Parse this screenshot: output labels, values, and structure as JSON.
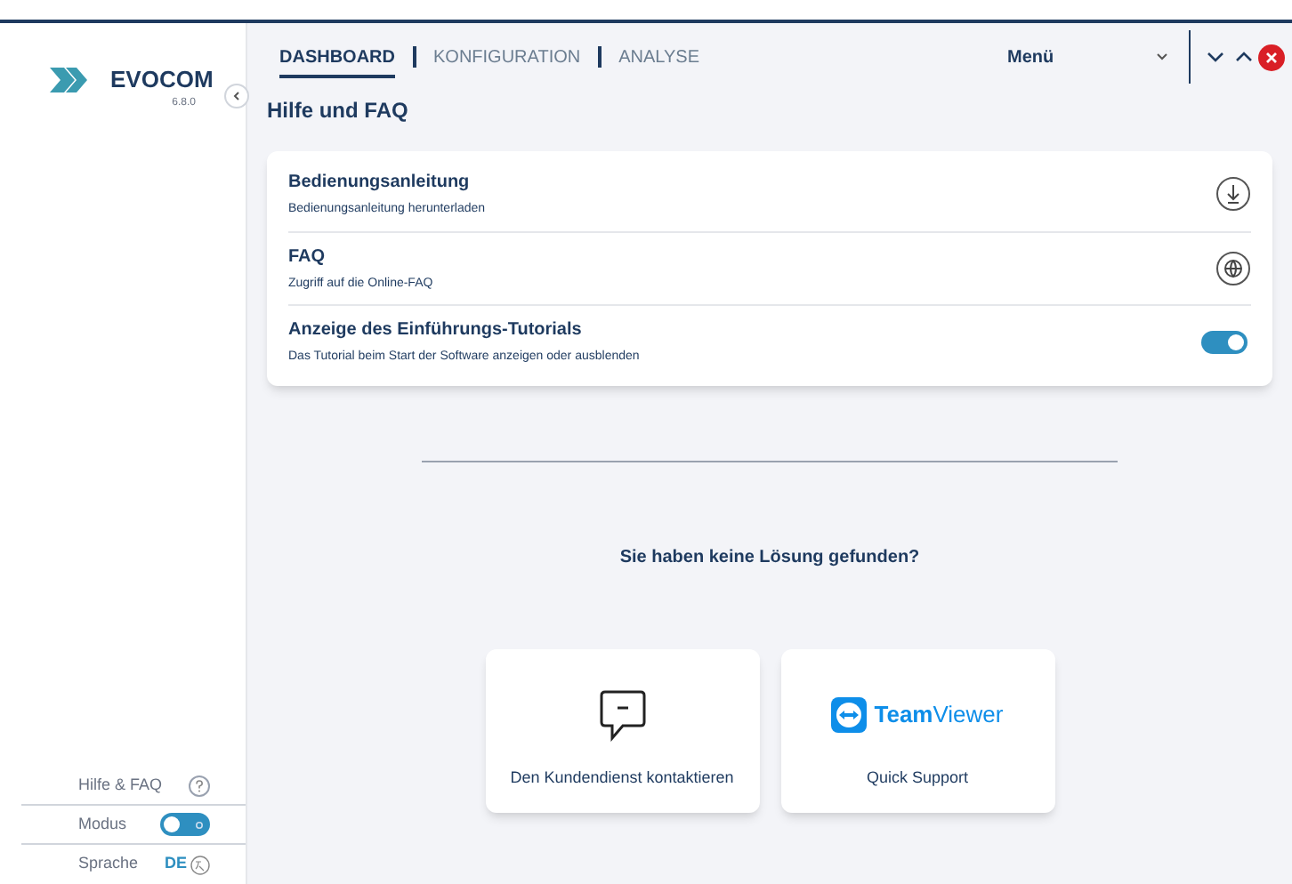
{
  "logo": {
    "name": "EVOCOM",
    "version": "6.8.0"
  },
  "tabs": [
    {
      "label": "DASHBOARD",
      "selected": true
    },
    {
      "label": "KONFIGURATION",
      "selected": false
    },
    {
      "label": "ANALYSE",
      "selected": false
    }
  ],
  "menu": {
    "label": "Menü"
  },
  "page_title": "Hilfe und FAQ",
  "settings": [
    {
      "kind": "download",
      "title": "Bedienungsanleitung",
      "description": "Bedienungsanleitung herunterladen"
    },
    {
      "kind": "link",
      "title": "FAQ",
      "description": "Zugriff auf die Online-FAQ"
    },
    {
      "kind": "toggle",
      "title": "Anzeige des Einführungs-Tutorials",
      "description": "Das Tutorial beim Start der Software anzeigen oder ausblenden",
      "on": true
    }
  ],
  "prompt": "Sie haben keine Lösung gefunden?",
  "support_cards": [
    {
      "kind": "contact",
      "label": "Den Kundendienst kontaktieren"
    },
    {
      "kind": "teamviewer",
      "logo_text": "**Team**Viewer",
      "label": "Quick Support"
    }
  ],
  "sidebar_footer": [
    {
      "kind": "help",
      "label": "Hilfe & FAQ"
    },
    {
      "kind": "mode",
      "label": "Modus",
      "dark": false
    },
    {
      "kind": "language",
      "label": "Sprache",
      "value": "DE"
    }
  ]
}
